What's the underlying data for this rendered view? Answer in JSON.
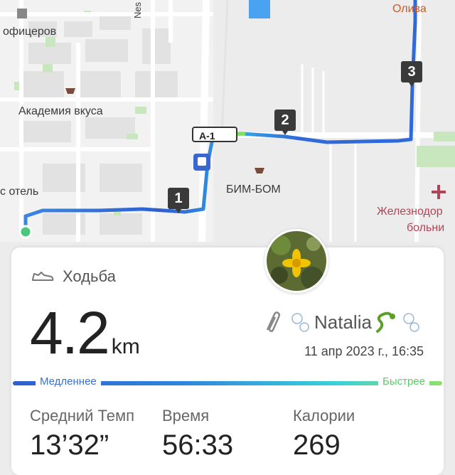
{
  "map": {
    "labels": {
      "officers": "офицеров",
      "academy": "Академия вкуса",
      "hotel": "с отель",
      "bimbom": "БИМ-БОМ",
      "station_hospital_1": "Железнодор",
      "station_hospital_2": "больни",
      "oliva": "Олива",
      "nes": "Nes"
    },
    "road_badge": "А-1",
    "markers": [
      "1",
      "2",
      "3"
    ],
    "route_colors": {
      "start": "#2f5fd0",
      "mid": "#34a7e6",
      "end": "#7fe05a"
    }
  },
  "card": {
    "activity": "Ходьба",
    "distance_value": "4.2",
    "distance_unit": "km",
    "user_name": "Natalia",
    "date": "11 апр 2023 г., 16:35",
    "pace_slow": "Медленнее",
    "pace_fast": "Быстрее",
    "stats": [
      {
        "label": "Средний Темп",
        "value": "13’32”"
      },
      {
        "label": "Время",
        "value": "56:33"
      },
      {
        "label": "Калории",
        "value": "269"
      }
    ]
  }
}
